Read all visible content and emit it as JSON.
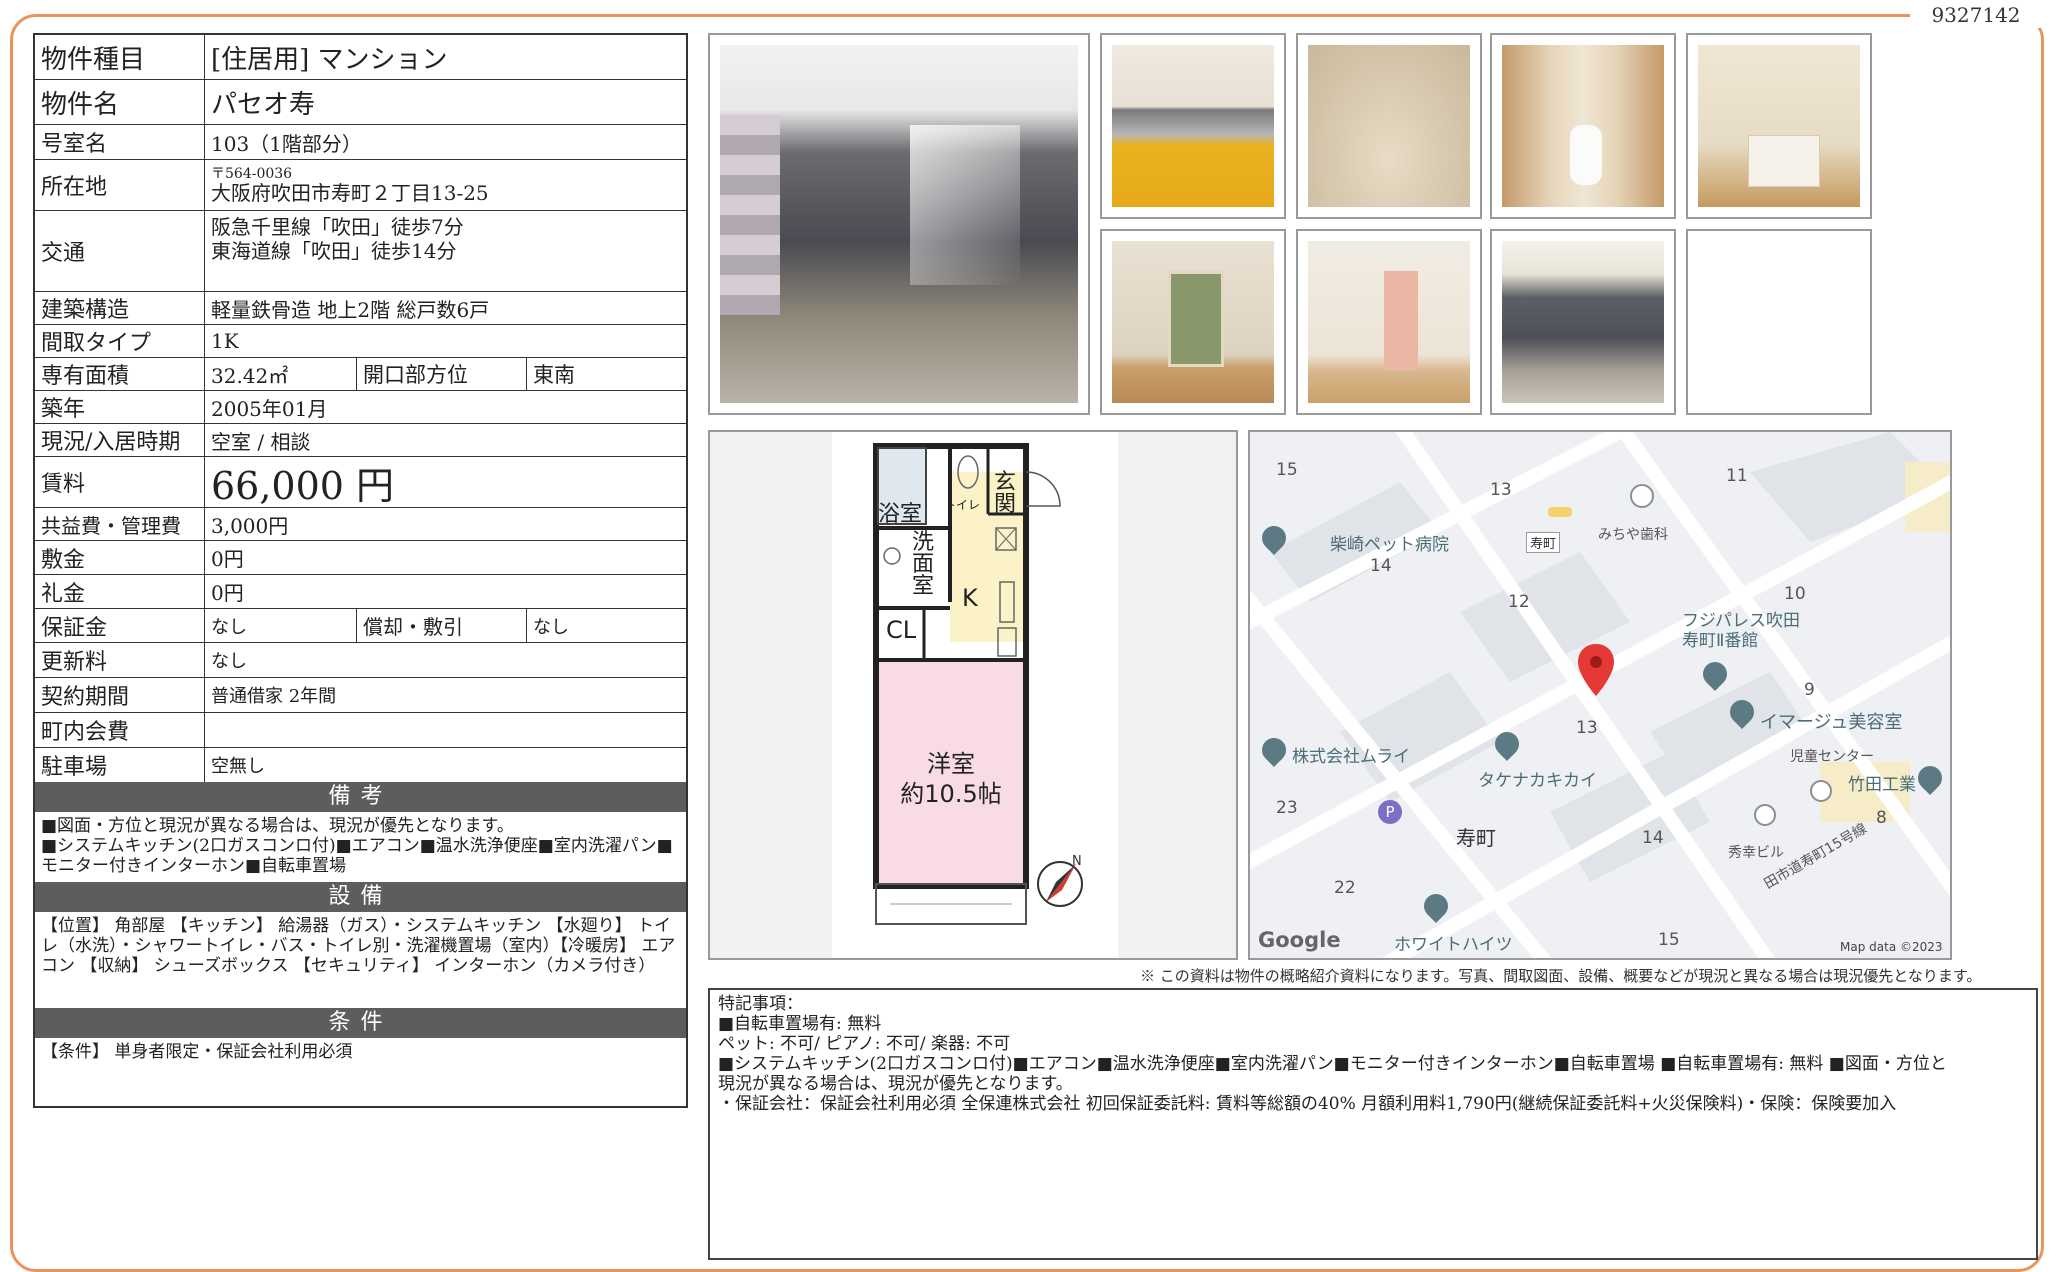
{
  "doc_id": "9327142",
  "property": {
    "type_label": "物件種目",
    "type_value": "[住居用] マンション",
    "name_label": "物件名",
    "name_value": "パセオ寿",
    "room_label": "号室名",
    "room_value": "103（1階部分）",
    "address_label": "所在地",
    "postal": "〒564-0036",
    "address": "大阪府吹田市寿町２丁目13-25",
    "transit_label": "交通",
    "transit_1": "阪急千里線「吹田」徒歩7分",
    "transit_2": "東海道線「吹田」徒歩14分",
    "structure_label": "建築構造",
    "structure_value": "軽量鉄骨造 地上2階 総戸数6戸",
    "layout_label": "間取タイプ",
    "layout_value": "1K",
    "area_label": "専有面積",
    "area_value": "32.42㎡",
    "opening_label": "開口部方位",
    "opening_value": "東南",
    "built_label": "築年",
    "built_value": "2005年01月",
    "status_label": "現況/入居時期",
    "status_value": "空室 / 相談",
    "rent_label": "賃料",
    "rent_value": "66,000 円",
    "fee_label": "共益費・管理費",
    "fee_value": "3,000円",
    "deposit_label": "敷金",
    "deposit_value": "0円",
    "key_label": "礼金",
    "key_value": "0円",
    "guarantee_label": "保証金",
    "guarantee_value": "なし",
    "amort_label": "償却・敷引",
    "amort_value": "なし",
    "renewal_label": "更新料",
    "renewal_value": "なし",
    "contract_label": "契約期間",
    "contract_value": "普通借家 2年間",
    "assoc_label": "町内会費",
    "assoc_value": "",
    "parking_label": "駐車場",
    "parking_value": "空無し"
  },
  "remarks": {
    "head": "備考",
    "line1": "■図面・方位と現況が異なる場合は、現況が優先となります。",
    "line2": "■システムキッチン(2口ガスコンロ付)■エアコン■温水洗浄便座■室内洗濯パン■モニター付きインターホン■自転車置場"
  },
  "equipment": {
    "head": "設備",
    "body": "【位置】 角部屋 【キッチン】 給湯器（ガス）・システムキッチン 【水廻り】 トイレ（水洗）・シャワートイレ・バス・トイレ別・洗濯機置場（室内）【冷暖房】 エアコン 【収納】 シューズボックス 【セキュリティ】 インターホン（カメラ付き）"
  },
  "conditions": {
    "head": "条件",
    "body": "【条件】 単身者限定・保証会社利用必須"
  },
  "floorplan": {
    "bath": "浴室",
    "toilet": "トイレ",
    "entrance": "玄関",
    "washroom": "洗面室",
    "kitchen": "K",
    "closet": "CL",
    "room": "洋室",
    "room_size": "約10.5帖",
    "north": "N"
  },
  "map": {
    "labels": [
      "15",
      "13",
      "11",
      "柴崎ペット病院",
      "14",
      "寿町",
      "みちや歯科",
      "12",
      "10",
      "フジパレス吹田",
      "寿町Ⅱ番館",
      "9",
      "イマージュ美容室",
      "13",
      "株式会社ムライ",
      "タケナカキカイ",
      "児童センター",
      "竹田工業",
      "23",
      "寿町",
      "14",
      "8",
      "秀幸ビル",
      "22",
      "ホワイトハイツ",
      "15",
      "田市道寿町15号線"
    ],
    "google": "Google",
    "credit": "Map data ©2023"
  },
  "notice": "※ この資料は物件の概略紹介資料になります。写真、間取図面、設備、概要などが現況と異なる場合は現況優先となります。",
  "notes": {
    "line1": "特記事項：",
    "line2": "■自転車置場有: 無料",
    "line3": "ペット: 不可/ ピアノ: 不可/ 楽器: 不可",
    "line4": "■システムキッチン(2口ガスコンロ付)■エアコン■温水洗浄便座■室内洗濯パン■モニター付きインターホン■自転車置場 ■自転車置場有: 無料 ■図面・方位と",
    "line5": "現況が異なる場合は、現況が優先となります。",
    "line6": "・保証会社：保証会社利用必須 全保連株式会社 初回保証委託料: 賃料等総額の40% 月額利用料1,790円(継続保証委託料+火災保険料)・保険：保険要加入"
  }
}
